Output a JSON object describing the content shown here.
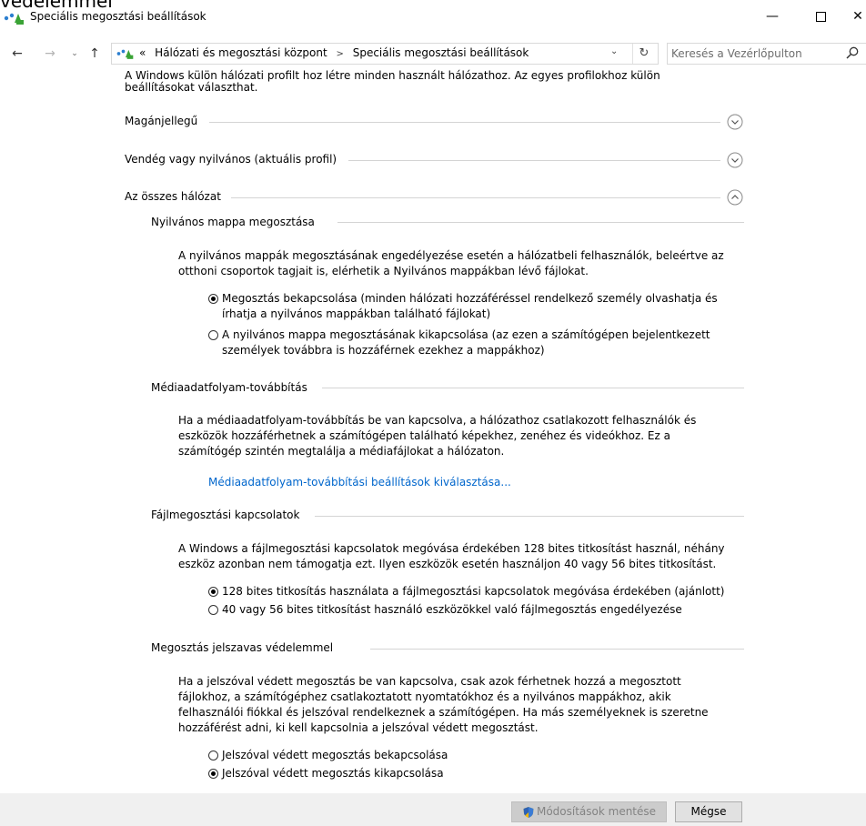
{
  "overflow_text": "védelemmel",
  "window": {
    "title": "Speciális megosztási beállítások",
    "minimize": "—",
    "close": "✕"
  },
  "nav": {
    "back": "←",
    "forward": "→",
    "recent": "⌄",
    "up": "↑",
    "breadcrumb_prefix": "«",
    "breadcrumb": [
      "Hálózati és megosztási központ",
      "Speciális megosztási beállítások"
    ],
    "breadcrumb_sep": ">",
    "dropdown": "⌄",
    "refresh": "↻",
    "search_placeholder": "Keresés a Vezérlőpulton"
  },
  "intro": [
    "A Windows külön hálózati profilt hoz létre minden használt hálózathoz. Az egyes profilokhoz külön",
    "beállításokat választhat."
  ],
  "profiles": [
    {
      "label": "Magánjellegű",
      "expanded": false
    },
    {
      "label": "Vendég vagy nyilvános (aktuális profil)",
      "expanded": false
    },
    {
      "label": "Az összes hálózat",
      "expanded": true
    }
  ],
  "sections": {
    "public_folder": {
      "heading": "Nyilvános mappa megosztása",
      "desc": [
        "A nyilvános mappák megosztásának engedélyezése esetén a hálózatbeli felhasználók, beleértve az",
        "otthoni csoportok tagjait is, elérhetik a Nyilvános mappákban lévő fájlokat."
      ],
      "options": [
        {
          "lines": [
            "Megosztás bekapcsolása (minden hálózati hozzáféréssel rendelkező személy olvashatja és",
            "írhatja a nyilvános mappákban található fájlokat)"
          ],
          "selected": true
        },
        {
          "lines": [
            "A nyilvános mappa megosztásának kikapcsolása (az ezen a számítógépen bejelentkezett",
            "személyek továbbra is hozzáférnek ezekhez a mappákhoz)"
          ],
          "selected": false
        }
      ]
    },
    "media": {
      "heading": "Médiaadatfolyam-továbbítás",
      "desc": [
        "Ha a médiaadatfolyam-továbbítás be van kapcsolva, a hálózathoz csatlakozott felhasználók és",
        "eszközök hozzáférhetnek a számítógépen található képekhez, zenéhez és videókhoz. Ez a",
        "számítógép szintén megtalálja a médiafájlokat a hálózaton."
      ],
      "link": "Médiaadatfolyam-továbbítási beállítások kiválasztása..."
    },
    "file_sharing": {
      "heading": "Fájlmegosztási kapcsolatok",
      "desc": [
        "A Windows a fájlmegosztási kapcsolatok megóvása érdekében 128 bites titkosítást használ, néhány",
        "eszköz azonban nem támogatja ezt. Ilyen eszközök esetén használjon 40 vagy 56 bites titkosítást."
      ],
      "options": [
        {
          "lines": [
            "128 bites titkosítás használata a fájlmegosztási kapcsolatok megóvása érdekében (ajánlott)"
          ],
          "selected": true
        },
        {
          "lines": [
            "40 vagy 56 bites titkosítást használó eszközökkel való fájlmegosztás engedélyezése"
          ],
          "selected": false
        }
      ]
    },
    "password": {
      "heading": "Megosztás jelszavas védelemmel",
      "desc": [
        "Ha a jelszóval védett megosztás be van kapcsolva, csak azok férhetnek hozzá a megosztott",
        "fájlokhoz, a számítógéphez csatlakoztatott nyomtatókhoz és a nyilvános mappákhoz, akik",
        "felhasználói fiókkal és jelszóval rendelkeznek a számítógépen. Ha más személyeknek is szeretne",
        "hozzáférést adni, ki kell kapcsolnia a jelszóval védett megosztást."
      ],
      "options": [
        {
          "lines": [
            "Jelszóval védett megosztás bekapcsolása"
          ],
          "selected": false
        },
        {
          "lines": [
            "Jelszóval védett megosztás kikapcsolása"
          ],
          "selected": true
        }
      ]
    }
  },
  "footer": {
    "save_label": "Módosítások mentése",
    "cancel_label": "Mégse"
  }
}
